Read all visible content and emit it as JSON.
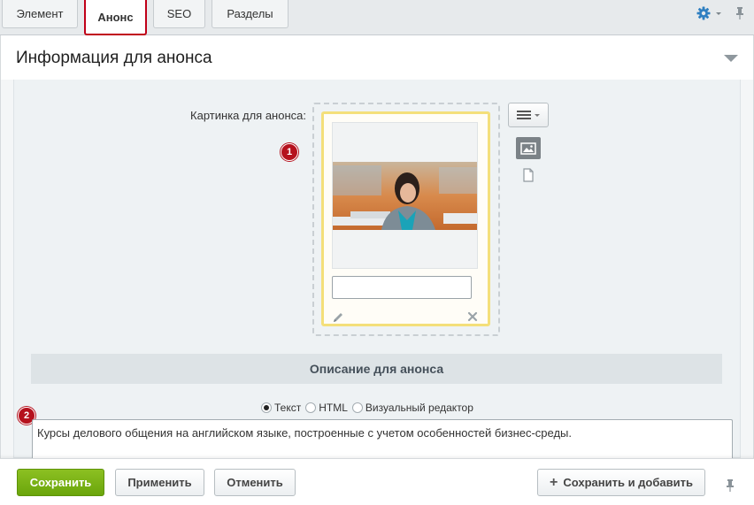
{
  "tabs": [
    {
      "label": "Элемент",
      "active": false
    },
    {
      "label": "Анонс",
      "active": true
    },
    {
      "label": "SEO",
      "active": false
    },
    {
      "label": "Разделы",
      "active": false
    }
  ],
  "section": {
    "title": "Информация для анонса"
  },
  "image_field": {
    "label": "Картинка для анонса:",
    "description_value": ""
  },
  "badges": [
    "1",
    "2"
  ],
  "description": {
    "bar_title": "Описание для анонса",
    "radio_options": [
      {
        "label": "Текст",
        "checked": true
      },
      {
        "label": "HTML",
        "checked": false
      },
      {
        "label": "Визуальный редактор",
        "checked": false
      }
    ],
    "text": "Курсы делового общения на английском языке, построенные с учетом особенностей бизнес-среды."
  },
  "footer": {
    "save_label": "Сохранить",
    "apply_label": "Применить",
    "cancel_label": "Отменить",
    "save_add_label": "Сохранить и добавить"
  },
  "icons": {
    "settings": "gear-icon",
    "pin": "pin-icon",
    "collapse": "triangle-down-icon",
    "menu": "hamburger-icon",
    "image_type": "image-icon",
    "file_type": "file-icon",
    "edit": "pencil-icon",
    "delete": "close-icon",
    "add": "plus-icon"
  },
  "colors": {
    "accent_green": "#6aa50b",
    "active_tab_border": "#c00018",
    "badge": "#b5111d",
    "gear": "#2f7fc1",
    "image_highlight": "#f4df7a"
  }
}
